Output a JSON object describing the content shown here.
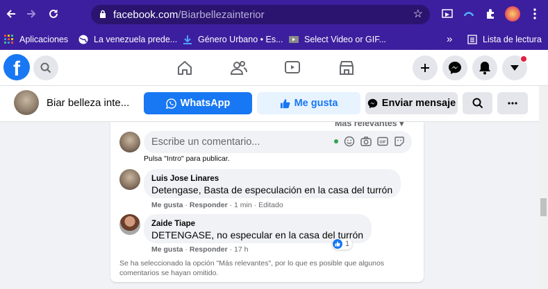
{
  "browser": {
    "url_domain": "facebook.com",
    "url_path": "/Biarbellezainterior",
    "bookmarks": [
      {
        "label": "Aplicaciones",
        "icon": "apps-grid-icon"
      },
      {
        "label": "La venezuela prede...",
        "icon": "globe-icon"
      },
      {
        "label": "Género Urbano • Es...",
        "icon": "download-icon"
      },
      {
        "label": "Select Video or GIF...",
        "icon": "video-icon"
      }
    ],
    "more_bookmarks": "»",
    "reading_list": "Lista de lectura"
  },
  "page": {
    "name": "Biar belleza inte...",
    "buttons": {
      "whatsapp": "WhatsApp",
      "like": "Me gusta",
      "message": "Enviar mensaje"
    }
  },
  "comments": {
    "sort_label": "Más relevantes ▾",
    "input_placeholder": "Escribe un comentario...",
    "hint": "Pulsa \"Intro\" para publicar.",
    "items": [
      {
        "author": "Luis Jose Linares",
        "text": "Detengase, Basta de especulación en la casa del turrón",
        "like": "Me gusta",
        "reply": "Responder",
        "time": "1 min",
        "edited": "Editado"
      },
      {
        "author": "Zaide Tiape",
        "text": "DETENGASE, no especular en la casa del turrón",
        "like": "Me gusta",
        "reply": "Responder",
        "time": "17 h",
        "reactions": "1"
      }
    ],
    "notice": "Se ha seleccionado la opción \"Más relevantes\", por lo que es posible que algunos comentarios se hayan omitido."
  },
  "colors": {
    "browser_bg": "#3c1f9e",
    "fb_blue": "#1877f2",
    "whatsapp_btn": "#1877f2",
    "like_btn_bg": "#e7f3ff"
  }
}
